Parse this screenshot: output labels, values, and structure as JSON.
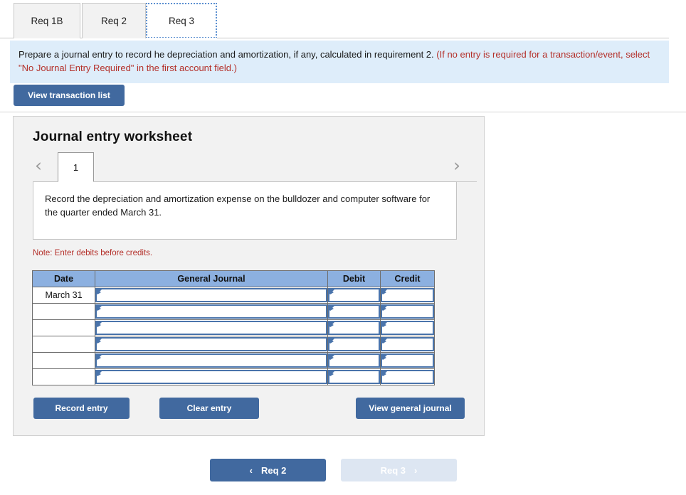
{
  "tabs": [
    {
      "label": "Req 1B",
      "active": false
    },
    {
      "label": "Req 2",
      "active": false
    },
    {
      "label": "Req 3",
      "active": true
    }
  ],
  "banner": {
    "main_text": "Prepare a journal entry to record he depreciation and amortization, if any, calculated in requirement 2.",
    "hint_text": "(If no entry is required for a transaction/event, select \"No Journal Entry Required\" in the first account field.)"
  },
  "toolbar": {
    "view_transaction_list_label": "View transaction list"
  },
  "worksheet": {
    "title": "Journal entry worksheet",
    "prev_icon": "chevron-left-icon",
    "next_icon": "chevron-right-icon",
    "pager": [
      {
        "label": "1",
        "active": true
      }
    ],
    "description": "Record the depreciation and amortization expense on the bulldozer and computer software for the quarter ended March 31.",
    "note": "Note: Enter debits before credits.",
    "table": {
      "headers": [
        "Date",
        "General Journal",
        "Debit",
        "Credit"
      ],
      "rows": [
        {
          "date": "March 31",
          "general_journal": "",
          "debit": "",
          "credit": ""
        },
        {
          "date": "",
          "general_journal": "",
          "debit": "",
          "credit": ""
        },
        {
          "date": "",
          "general_journal": "",
          "debit": "",
          "credit": ""
        },
        {
          "date": "",
          "general_journal": "",
          "debit": "",
          "credit": ""
        },
        {
          "date": "",
          "general_journal": "",
          "debit": "",
          "credit": ""
        },
        {
          "date": "",
          "general_journal": "",
          "debit": "",
          "credit": ""
        }
      ]
    },
    "buttons": {
      "record_entry_label": "Record entry",
      "clear_entry_label": "Clear entry",
      "view_general_journal_label": "View general journal"
    }
  },
  "footer_nav": {
    "prev_label": "Req 2",
    "prev_icon": "chevron-left-icon",
    "next_label": "Req 3",
    "next_icon": "chevron-right-icon",
    "next_disabled": true
  },
  "colors": {
    "accent_blue": "#41699f",
    "banner_bg": "#deedfa",
    "hint_red": "#b4302a",
    "table_header_blue": "#8cb0e0",
    "input_border_blue": "#4a74ab",
    "panel_bg": "#f2f2f2",
    "disabled_nav": "#dde6f2"
  }
}
